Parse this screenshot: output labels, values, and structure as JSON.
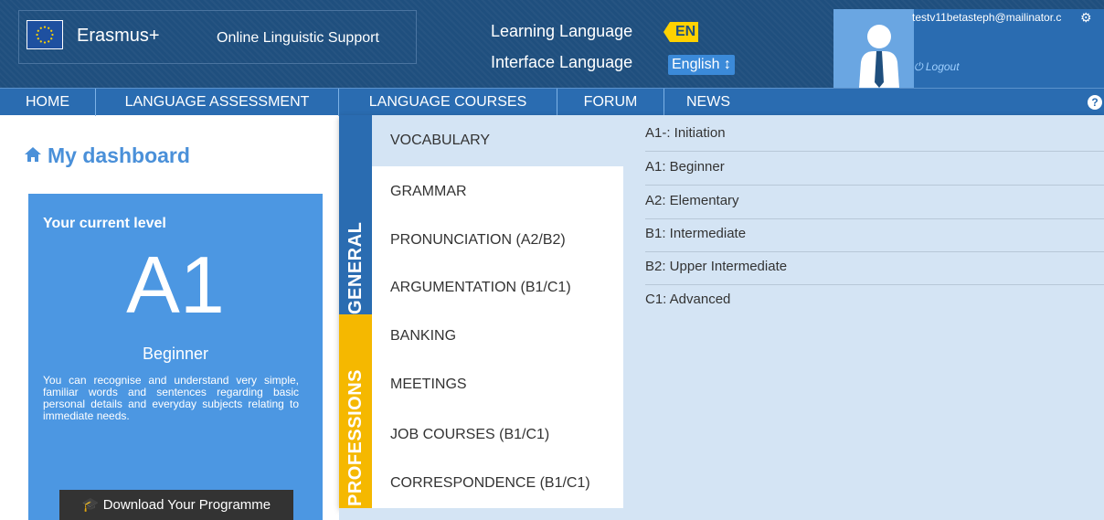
{
  "header": {
    "brand": "Erasmus+",
    "subtitle": "Online Linguistic Support",
    "learning_language_label": "Learning Language",
    "learning_language_code": "EN",
    "interface_language_label": "Interface Language",
    "interface_language_value": "English ↕",
    "user_email": "testv11betasteph@mailinator.c",
    "logout_label": "Logout"
  },
  "nav": {
    "items": [
      "HOME",
      "LANGUAGE ASSESSMENT",
      "LANGUAGE COURSES",
      "FORUM",
      "NEWS"
    ],
    "help_label": "?"
  },
  "dashboard": {
    "title": "My dashboard",
    "level_label": "Your current level",
    "level_code": "A1",
    "level_name": "Beginner",
    "level_description": "You can recognise and understand very simple, familiar words and sentences regarding basic personal details and everyday subjects relating to immediate needs.",
    "download_label": "Download Your Programme"
  },
  "mega_menu": {
    "general_tab": "GENERAL",
    "professions_tab": "PROFESSIONS",
    "courses": [
      "VOCABULARY",
      "GRAMMAR",
      "PRONUNCIATION (A2/B2)",
      "ARGUMENTATION (B1/C1)",
      "BANKING",
      "MEETINGS",
      "JOB COURSES (B1/C1)",
      "CORRESPONDENCE (B1/C1)"
    ],
    "levels": [
      "A1-: Initiation",
      "A1: Beginner",
      "A2: Elementary",
      "B1: Intermediate",
      "B2: Upper Intermediate",
      "C1: Advanced"
    ]
  },
  "colors": {
    "header_bg": "#1f4f7e",
    "nav_bg": "#2a6cb1",
    "level_card_bg": "#4c97e2",
    "professions_tab": "#f5b800",
    "badge_yellow": "#ffd200"
  }
}
